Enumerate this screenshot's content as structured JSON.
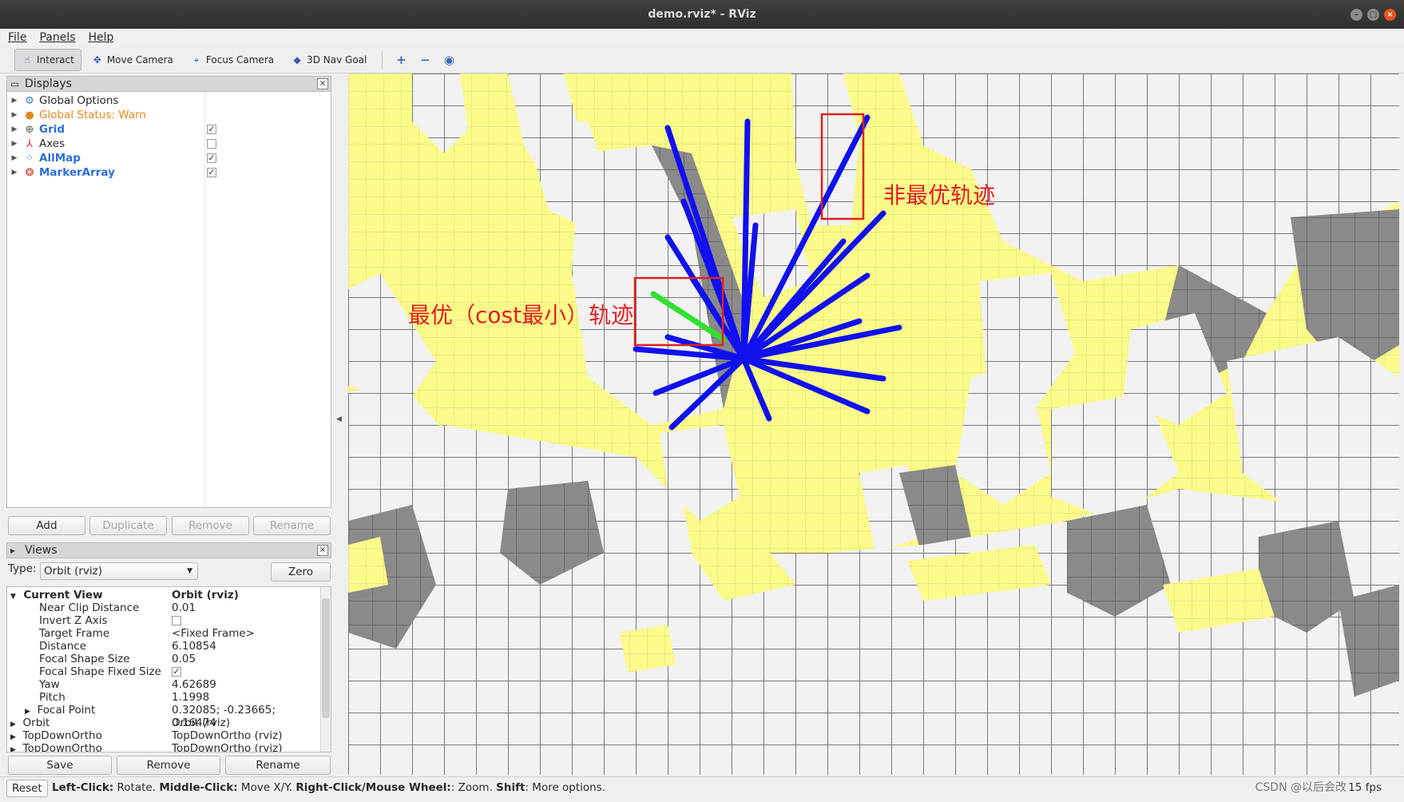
{
  "window": {
    "title": "demo.rviz* - RViz"
  },
  "menu": [
    "File",
    "Panels",
    "Help"
  ],
  "toolbar": {
    "tools": [
      {
        "label": "Interact",
        "icon": "hand-icon"
      },
      {
        "label": "Move Camera",
        "icon": "move-camera-icon"
      },
      {
        "label": "Focus Camera",
        "icon": "focus-camera-icon"
      },
      {
        "label": "3D Nav Goal",
        "icon": "nav-goal-icon"
      }
    ]
  },
  "displays": {
    "title": "Displays",
    "items": [
      {
        "label": "Global Options",
        "checked": null
      },
      {
        "label": "Global Status: Warn",
        "checked": null
      },
      {
        "label": "Grid",
        "checked": true
      },
      {
        "label": "Axes",
        "checked": false
      },
      {
        "label": "AllMap",
        "checked": true
      },
      {
        "label": "MarkerArray",
        "checked": true
      }
    ],
    "buttons": {
      "add": "Add",
      "duplicate": "Duplicate",
      "remove": "Remove",
      "rename": "Rename"
    }
  },
  "views": {
    "title": "Views",
    "type_label": "Type:",
    "type_value": "Orbit (rviz)",
    "zero": "Zero",
    "current_view": {
      "label": "Current View",
      "value": "Orbit (rviz)"
    },
    "properties": [
      {
        "key": "Near Clip Distance",
        "value": "0.01"
      },
      {
        "key": "Invert Z Axis",
        "value": ""
      },
      {
        "key": "Target Frame",
        "value": "<Fixed Frame>"
      },
      {
        "key": "Distance",
        "value": "6.10854"
      },
      {
        "key": "Focal Shape Size",
        "value": "0.05"
      },
      {
        "key": "Focal Shape Fixed Size",
        "value": "✓"
      },
      {
        "key": "Yaw",
        "value": "4.62689"
      },
      {
        "key": "Pitch",
        "value": "1.1998"
      },
      {
        "key": "Focal Point",
        "value": "0.32085; -0.23665; 0.16474"
      }
    ],
    "saved": [
      {
        "key": "Orbit",
        "value": "Orbit (rviz)"
      },
      {
        "key": "TopDownOrtho",
        "value": "TopDownOrtho (rviz)"
      },
      {
        "key": "TopDownOrtho",
        "value": "TopDownOrtho (rviz)"
      }
    ],
    "buttons": {
      "save": "Save",
      "remove": "Remove",
      "rename": "Rename"
    }
  },
  "viewport": {
    "annotation_optimal": "最优（cost最小）轨迹",
    "annotation_nonoptimal": "非最优轨迹",
    "colors": {
      "floor": "#fbfb8a",
      "trajectory": "#1010f0",
      "best": "#30e030",
      "box": "#e02020"
    }
  },
  "status": {
    "reset": "Reset",
    "message_parts": [
      {
        "b": "Left-Click:",
        "t": " Rotate. "
      },
      {
        "b": "Middle-Click:",
        "t": " Move X/Y. "
      },
      {
        "b": "Right-Click/Mouse Wheel:",
        "t": ": Zoom. "
      },
      {
        "b": "Shift",
        "t": ": More options."
      }
    ],
    "fps": "15 fps",
    "watermark": "CSDN @以后会改"
  }
}
